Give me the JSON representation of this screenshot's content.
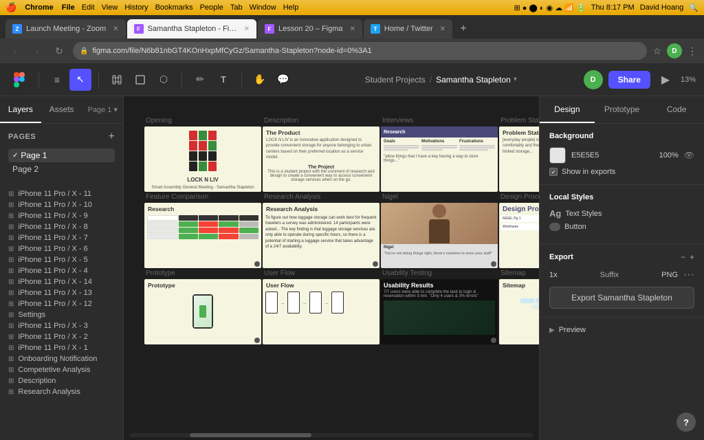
{
  "menubar": {
    "apple": "🍎",
    "app": "Chrome",
    "items": [
      "File",
      "Edit",
      "View",
      "History",
      "Bookmarks",
      "People",
      "Tab",
      "Window",
      "Help"
    ],
    "time": "Thu 8:17 PM",
    "user": "David Hoang"
  },
  "browser": {
    "tabs": [
      {
        "id": "tab-zoom",
        "favicon_color": "#2D8CFF",
        "favicon_letter": "Z",
        "label": "Launch Meeting - Zoom",
        "active": false
      },
      {
        "id": "tab-figma-main",
        "favicon_color": "#A259FF",
        "favicon_letter": "F",
        "label": "Samantha Stapleton - Figma",
        "active": true
      },
      {
        "id": "tab-figma-lesson",
        "favicon_color": "#A259FF",
        "favicon_letter": "F",
        "label": "Lesson 20 – Figma",
        "active": false
      },
      {
        "id": "tab-twitter",
        "favicon_color": "#1DA1F2",
        "favicon_letter": "T",
        "label": "Home / Twitter",
        "active": false
      }
    ],
    "url": "figma.com/file/N6b81nbGT4KOnHxpMfCyGz/Samantha-Stapleton?node-id=0%3A1"
  },
  "figma": {
    "toolbar": {
      "breadcrumb": "Student Projects",
      "separator": "/",
      "current_file": "Samantha Stapleton",
      "dropdown_icon": "▾",
      "avatar_letter": "D",
      "avatar_color": "#4caf50",
      "share_label": "Share",
      "zoom": "13%"
    },
    "tools": [
      {
        "id": "menu",
        "icon": "≡",
        "active": false
      },
      {
        "id": "select",
        "icon": "↖",
        "active": true
      },
      {
        "id": "frame",
        "icon": "⊞",
        "active": false
      },
      {
        "id": "shape",
        "icon": "⬡",
        "active": false
      },
      {
        "id": "pen",
        "icon": "✏",
        "active": false
      },
      {
        "id": "text",
        "icon": "T",
        "active": false
      },
      {
        "id": "hand",
        "icon": "✋",
        "active": false
      },
      {
        "id": "comment",
        "icon": "💬",
        "active": false
      }
    ]
  },
  "left_panel": {
    "tabs": [
      "Layers",
      "Assets"
    ],
    "page_label": "Page 1",
    "pages_label": "Pages",
    "pages_add_icon": "+",
    "pages": [
      {
        "id": "page1",
        "label": "Page 1",
        "active": true
      },
      {
        "id": "page2",
        "label": "Page 2",
        "active": false
      }
    ],
    "layers": [
      {
        "id": "iphone11-11",
        "label": "iPhone 11 Pro / X - 11"
      },
      {
        "id": "iphone11-10",
        "label": "iPhone 11 Pro / X - 10"
      },
      {
        "id": "iphone11-9",
        "label": "iPhone 11 Pro / X - 9"
      },
      {
        "id": "iphone11-8",
        "label": "iPhone 11 Pro / X - 8"
      },
      {
        "id": "iphone11-7",
        "label": "iPhone 11 Pro / X - 7"
      },
      {
        "id": "iphone11-6",
        "label": "iPhone 11 Pro / X - 6"
      },
      {
        "id": "iphone11-5",
        "label": "iPhone 11 Pro / X - 5"
      },
      {
        "id": "iphone11-4",
        "label": "iPhone 11 Pro / X - 4"
      },
      {
        "id": "iphone11-14",
        "label": "iPhone 11 Pro / X - 14"
      },
      {
        "id": "iphone11-13",
        "label": "iPhone 11 Pro / X - 13"
      },
      {
        "id": "iphone11-12",
        "label": "iPhone 11 Pro / X - 12"
      },
      {
        "id": "settings",
        "label": "Settings"
      },
      {
        "id": "iphone11-3",
        "label": "iPhone 11 Pro / X - 3"
      },
      {
        "id": "iphone11-2",
        "label": "iPhone 11 Pro / X - 2"
      },
      {
        "id": "iphone11-1",
        "label": "iPhone 11 Pro / X - 1"
      },
      {
        "id": "onboarding",
        "label": "Onboarding Notification"
      },
      {
        "id": "competitive",
        "label": "Competetive Analysis"
      },
      {
        "id": "description",
        "label": "Description"
      },
      {
        "id": "research",
        "label": "Research Analysis"
      }
    ]
  },
  "canvas": {
    "frames": [
      {
        "id": "opening",
        "label": "Opening",
        "title": "",
        "bg": "cream",
        "has_indicator": false
      },
      {
        "id": "description",
        "label": "Description",
        "title": "The Product",
        "bg": "cream",
        "has_indicator": false
      },
      {
        "id": "interviews",
        "label": "Interviews",
        "title": "Research",
        "bg": "cream",
        "has_indicator": false
      },
      {
        "id": "problem",
        "label": "Problem Statement",
        "title": "Problem Statement",
        "bg": "cream",
        "has_indicator": false
      },
      {
        "id": "feature",
        "label": "Feature Comparison",
        "title": "Research",
        "bg": "cream",
        "has_indicator": true
      },
      {
        "id": "analysis",
        "label": "Research Analysis",
        "title": "Research Analysis",
        "bg": "cream",
        "has_indicator": true
      },
      {
        "id": "nigel",
        "label": "Nigel",
        "title": "",
        "bg": "gray",
        "has_indicator": true
      },
      {
        "id": "design",
        "label": "Design Process",
        "title": "Design Process",
        "bg": "cream",
        "has_indicator": true
      },
      {
        "id": "prototype",
        "label": "Prototype",
        "title": "Prototype",
        "bg": "cream",
        "has_indicator": true
      },
      {
        "id": "userflow",
        "label": "User Flow",
        "title": "User Flow",
        "bg": "cream",
        "has_indicator": false
      },
      {
        "id": "usability",
        "label": "Usability Testing",
        "title": "Usability Results",
        "bg": "dark",
        "has_indicator": true
      },
      {
        "id": "sitemap",
        "label": "Sitemap",
        "title": "Sitemap",
        "bg": "cream",
        "has_indicator": false
      }
    ]
  },
  "right_panel": {
    "tabs": [
      "Design",
      "Prototype",
      "Code"
    ],
    "background_section": {
      "label": "Background",
      "color_hex": "E5E5E5",
      "opacity": "100%",
      "eye_icon": "👁",
      "show_in_exports": "Show in exports"
    },
    "local_styles_section": {
      "label": "Local Styles",
      "text_styles_label": "Text Styles",
      "button_label": "Button"
    },
    "export_section": {
      "label": "Export",
      "minus_icon": "−",
      "plus_icon": "+",
      "scale": "1x",
      "suffix_label": "Suffix",
      "format": "PNG",
      "more_icon": "···",
      "export_btn_label": "Export Samantha Stapleton"
    },
    "preview_section": {
      "label": "Preview",
      "arrow": "▶"
    }
  },
  "help_btn": "?"
}
